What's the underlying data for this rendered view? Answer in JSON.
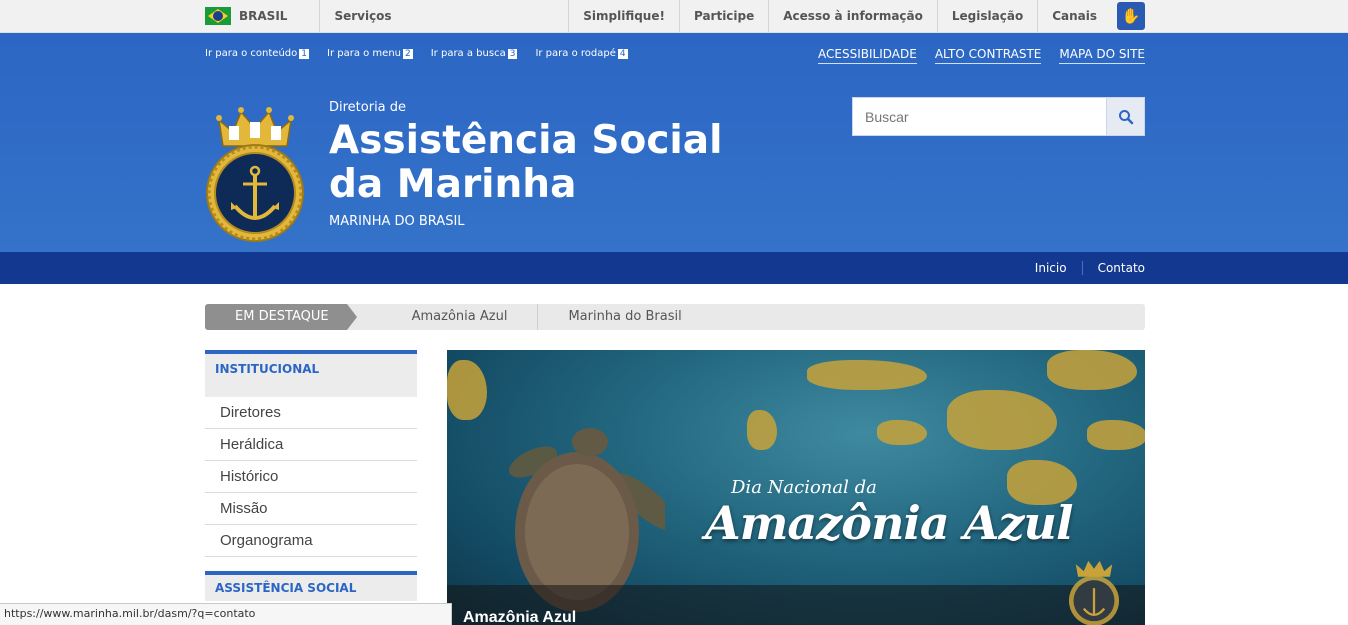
{
  "govbar": {
    "country": "BRASIL",
    "services": "Serviços",
    "links": [
      "Simplifique!",
      "Participe",
      "Acesso à informação",
      "Legislação",
      "Canais"
    ]
  },
  "header": {
    "skip_links": [
      {
        "label": "Ir para o conteúdo",
        "key": "1"
      },
      {
        "label": "Ir para o menu",
        "key": "2"
      },
      {
        "label": "Ir para a busca",
        "key": "3"
      },
      {
        "label": "Ir para o rodapé",
        "key": "4"
      }
    ],
    "access_links": [
      "ACESSIBILIDADE",
      "ALTO CONTRASTE",
      "MAPA DO SITE"
    ],
    "pre_title": "Diretoria de",
    "title": "Assistência Social da Marinha",
    "subtitle": "MARINHA DO BRASIL",
    "logo_text": "MARINHA DO BRASIL",
    "search_placeholder": "Buscar"
  },
  "nav": [
    "Inicio",
    "Contato"
  ],
  "destaques": {
    "label": "EM DESTAQUE",
    "items": [
      "Amazônia Azul",
      "Marinha do Brasil"
    ]
  },
  "sidebar": {
    "section1": "INSTITUCIONAL",
    "items": [
      "Diretores",
      "Heráldica",
      "Histórico",
      "Missão",
      "Organograma"
    ],
    "section2": "ASSISTÊNCIA SOCIAL"
  },
  "banner": {
    "pre_title": "Dia Nacional da",
    "title": "Amazônia Azul",
    "caption": "Amazônia Azul"
  },
  "statusbar": "https://www.marinha.mil.br/dasm/?q=contato",
  "colors": {
    "primary": "#2c66c4",
    "nav": "#12398f",
    "gold": "#c8a23a"
  }
}
